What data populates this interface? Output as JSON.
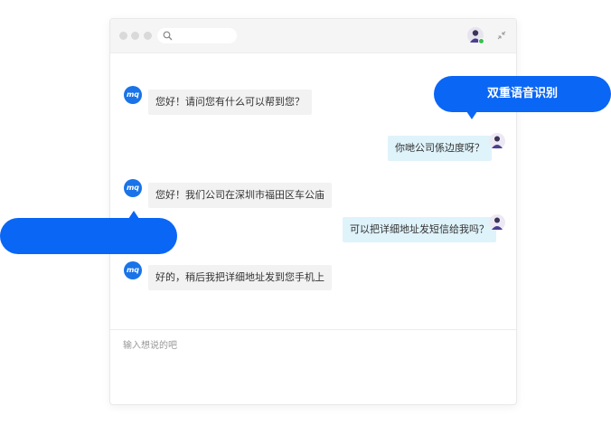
{
  "window": {
    "title_bar": {
      "search": {
        "icon": "search-icon",
        "placeholder": ""
      },
      "user_avatar": "avatar",
      "collapse_icon": "collapse-icon"
    }
  },
  "messages": [
    {
      "from": "bot",
      "avatar_text": "mq",
      "text": "您好！请问您有什么可以帮到您？"
    },
    {
      "from": "user",
      "text": "你哋公司係边度呀？"
    },
    {
      "from": "bot",
      "avatar_text": "mq",
      "text": "您好！我们公司在深圳市福田区车公庙"
    },
    {
      "from": "user",
      "text": "可以把详细地址发短信给我吗？"
    },
    {
      "from": "bot",
      "avatar_text": "mq",
      "text": "好的，稍后我把详细地址发到您手机上"
    }
  ],
  "input": {
    "placeholder": "输入想说的吧"
  },
  "callouts": {
    "top_right": "双重语音识别",
    "left": ""
  },
  "colors": {
    "accent_blue": "#0a66f5",
    "bot_bubble": "#f2f2f2",
    "user_bubble": "#dff3fb",
    "bot_avatar": "#1a73e8"
  }
}
